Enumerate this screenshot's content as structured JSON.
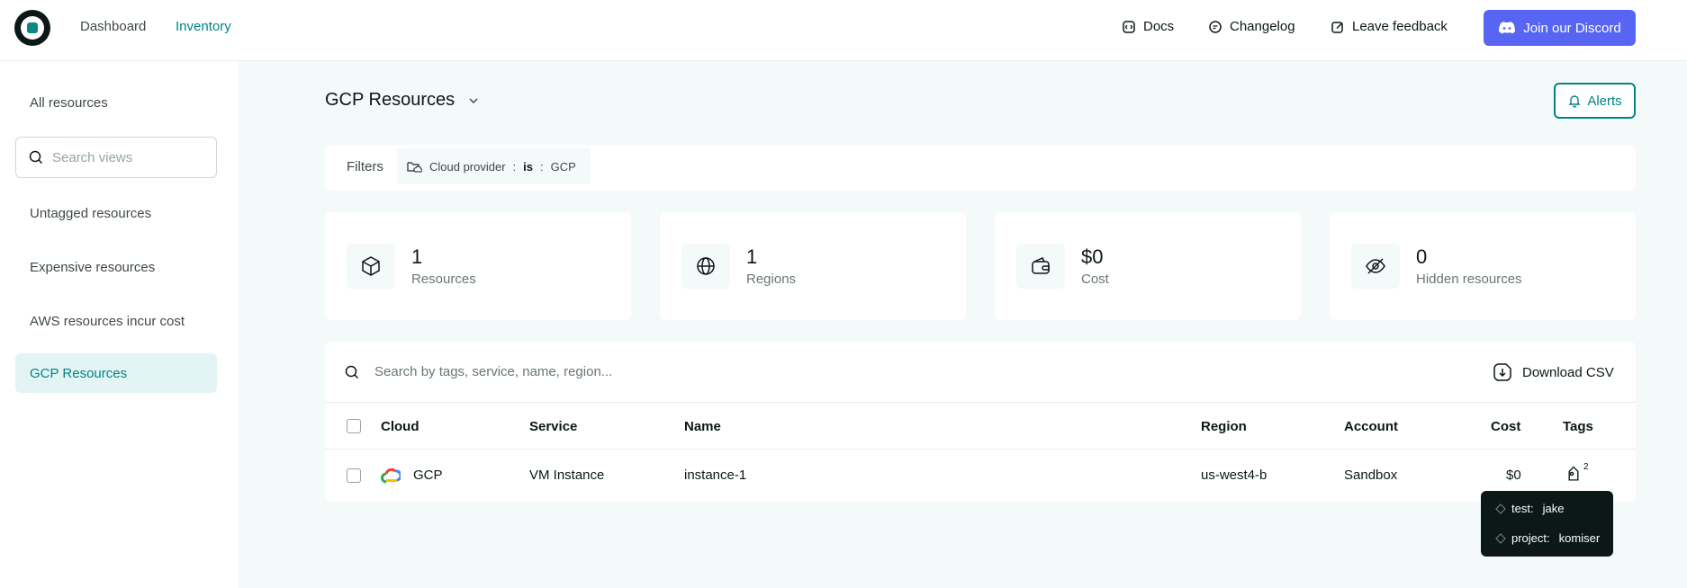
{
  "nav": {
    "links": [
      {
        "label": "Dashboard"
      },
      {
        "label": "Inventory"
      }
    ],
    "docs": "Docs",
    "changelog": "Changelog",
    "feedback": "Leave feedback",
    "discord": "Join our Discord"
  },
  "sidebar": {
    "all_resources": "All resources",
    "search_placeholder": "Search views",
    "items": [
      {
        "label": "Untagged resources"
      },
      {
        "label": "Expensive resources"
      },
      {
        "label": "AWS resources incur cost"
      },
      {
        "label": "GCP Resources"
      }
    ]
  },
  "main": {
    "title": "GCP Resources",
    "alerts": "Alerts",
    "filters_label": "Filters",
    "filter": {
      "field": "Cloud provider",
      "sep1": ":",
      "op": "is",
      "sep2": ":",
      "value": "GCP"
    },
    "stats": [
      {
        "value": "1",
        "caption": "Resources",
        "icon": "cube-icon"
      },
      {
        "value": "1",
        "caption": "Regions",
        "icon": "globe-icon"
      },
      {
        "value": "$0",
        "caption": "Cost",
        "icon": "wallet-icon"
      },
      {
        "value": "0",
        "caption": "Hidden resources",
        "icon": "eye-off-icon"
      }
    ]
  },
  "table": {
    "search_placeholder": "Search by tags, service, name, region...",
    "download": "Download CSV",
    "columns": [
      "Cloud",
      "Service",
      "Name",
      "Region",
      "Account",
      "Cost",
      "Tags"
    ],
    "rows": [
      {
        "cloud": "GCP",
        "service": "VM Instance",
        "name": "instance-1",
        "region": "us-west4-b",
        "account": "Sandbox",
        "cost": "$0",
        "tag_count": "2"
      }
    ]
  },
  "tooltip": {
    "tags": [
      {
        "key": "test:",
        "value": "jake"
      },
      {
        "key": "project:",
        "value": "komiser"
      }
    ]
  },
  "colors": {
    "accent": "#008484",
    "discord": "#5865f2",
    "dark": "#0c1717"
  }
}
